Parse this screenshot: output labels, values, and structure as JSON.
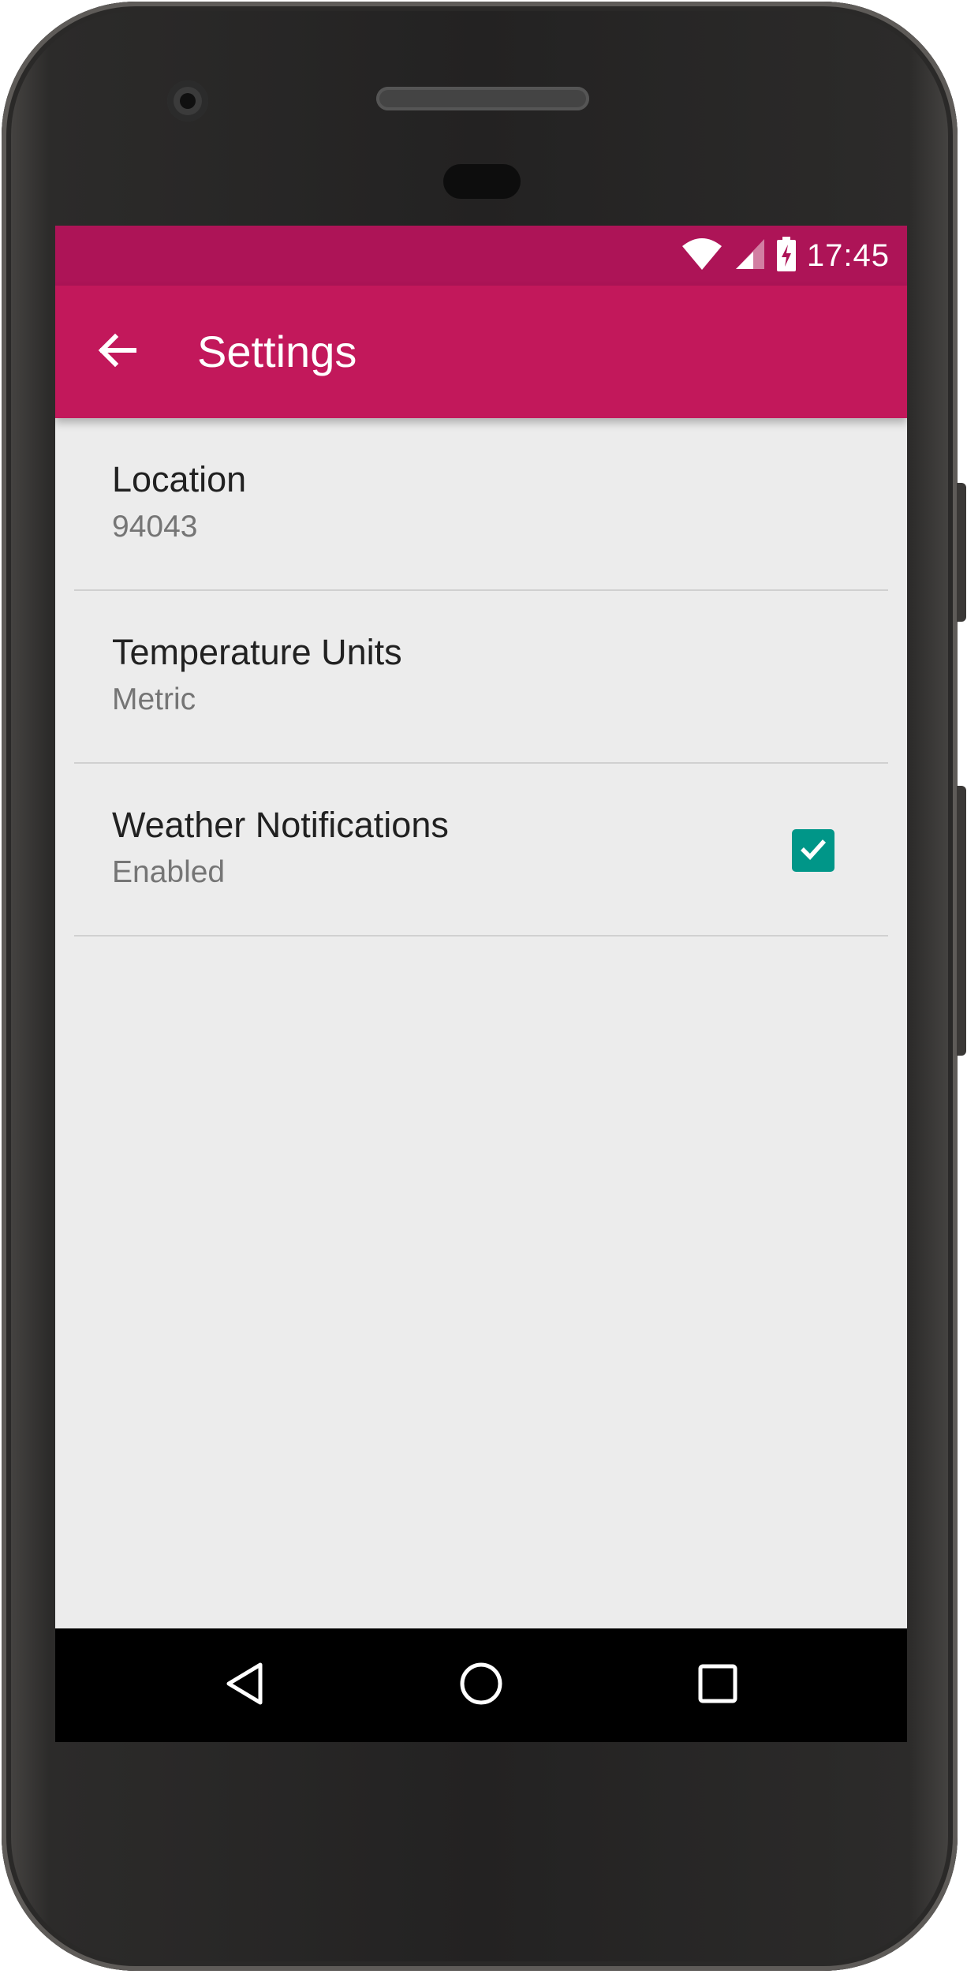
{
  "status_bar": {
    "time": "17:45",
    "icons": [
      "wifi-icon",
      "cell-signal-icon",
      "battery-charging-icon"
    ]
  },
  "app_bar": {
    "title": "Settings",
    "back_icon": "arrow-back-icon"
  },
  "colors": {
    "status_bar": "#ad1457",
    "app_bar": "#c2185b",
    "checkbox": "#009688",
    "background": "#ececec"
  },
  "preferences": [
    {
      "title": "Location",
      "summary": "94043"
    },
    {
      "title": "Temperature Units",
      "summary": "Metric"
    },
    {
      "title": "Weather Notifications",
      "summary": "Enabled",
      "checked": true
    }
  ],
  "nav_bar": {
    "icons": [
      "nav-back-icon",
      "nav-home-icon",
      "nav-recents-icon"
    ]
  }
}
